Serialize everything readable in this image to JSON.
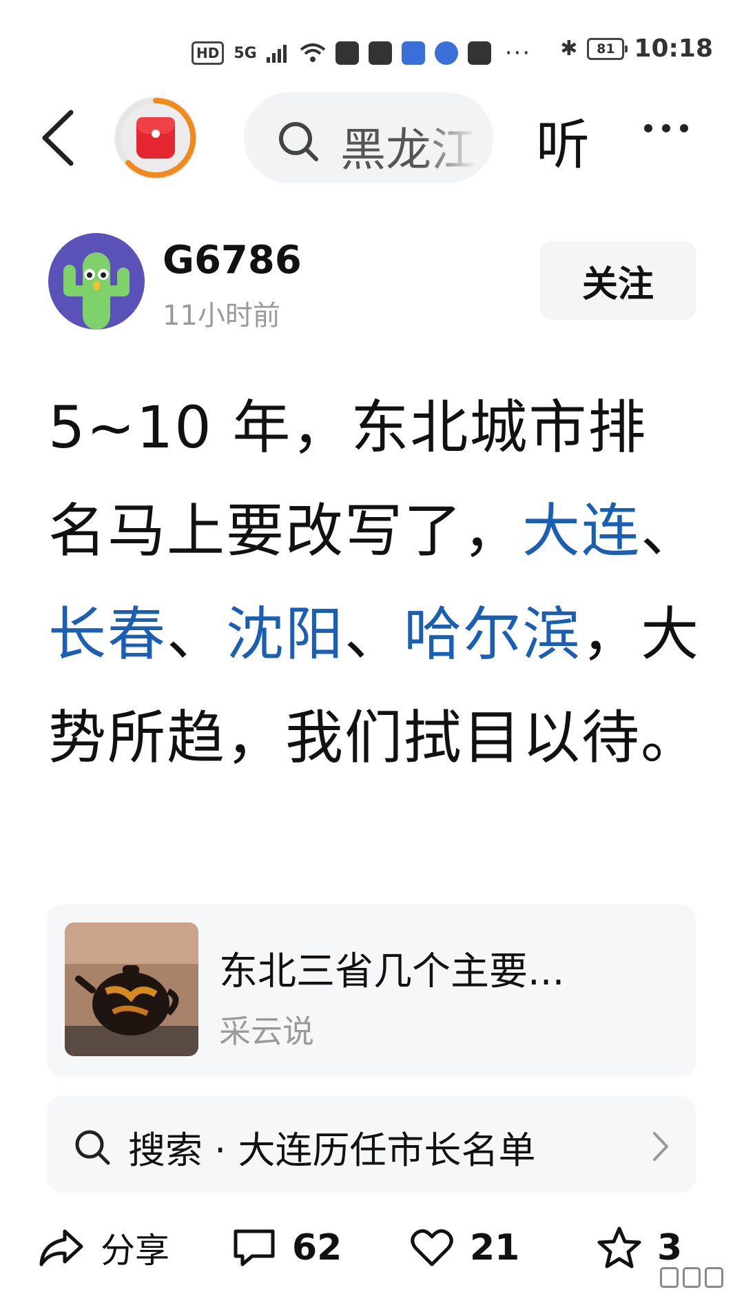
{
  "status_bar": {
    "hd": "HD",
    "signal": "5G",
    "icons": [
      "wifi-icon",
      "baidu-paw-icon",
      "calendar-icon",
      "security-icon",
      "browser-icon",
      "baidu-paw-icon"
    ],
    "overflow": "···",
    "bluetooth": "bluetooth-icon",
    "battery": "81",
    "time": "10:18"
  },
  "nav": {
    "back": "back-chevron-icon",
    "red_packet": "red-envelope-icon",
    "search_text": "黑龙江",
    "listen": "听",
    "more": "more-dots-icon"
  },
  "author": {
    "name": "G6786",
    "time": "11小时前",
    "follow": "关注",
    "avatar": "cactus-avatar"
  },
  "post": {
    "t1": "5~10 年，东北城市排名马上要改写了，",
    "l1": "大连",
    "s1": "、",
    "l2": "长春",
    "s2": "、",
    "l3": "沈阳",
    "s3": "、",
    "l4": "哈尔滨",
    "t2": "，大势所趋，我们拭目以待。"
  },
  "card": {
    "title": "东北三省几个主要...",
    "source": "采云说",
    "thumb": "teapot-image"
  },
  "suggestion": {
    "label": "搜索 · 大连历任市长名单"
  },
  "bottom": {
    "share": "分享",
    "comments": "62",
    "likes": "21",
    "favorites": "3"
  },
  "colors": {
    "link": "#1a5fb4",
    "progress_ring": "#f08a1c",
    "red_envelope": "#e3262f",
    "avatar_bg": "#5a52b8",
    "cactus": "#7ed16b"
  }
}
